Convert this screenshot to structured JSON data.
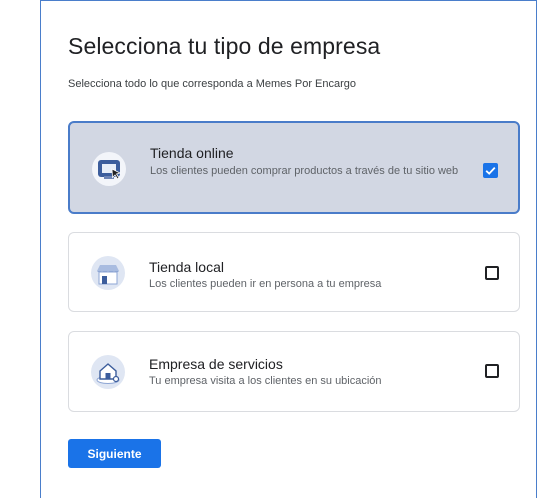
{
  "page": {
    "title": "Selecciona tu tipo de empresa",
    "subtitle": "Selecciona todo lo que corresponda a Memes Por Encargo"
  },
  "options": [
    {
      "title": "Tienda online",
      "description": "Los clientes pueden comprar productos a través de tu sitio web",
      "icon": "online-store-icon",
      "checked": true
    },
    {
      "title": "Tienda local",
      "description": "Los clientes pueden ir en persona a tu empresa",
      "icon": "storefront-icon",
      "checked": false
    },
    {
      "title": "Empresa de servicios",
      "description": "Tu empresa visita a los clientes en su ubicación",
      "icon": "service-area-icon",
      "checked": false
    }
  ],
  "actions": {
    "next_label": "Siguiente"
  },
  "colors": {
    "accent": "#1a73e8",
    "selected_bg": "#d2d7e3",
    "selected_border": "#4a7cc9",
    "icon_circle": "#dfe6f3"
  }
}
